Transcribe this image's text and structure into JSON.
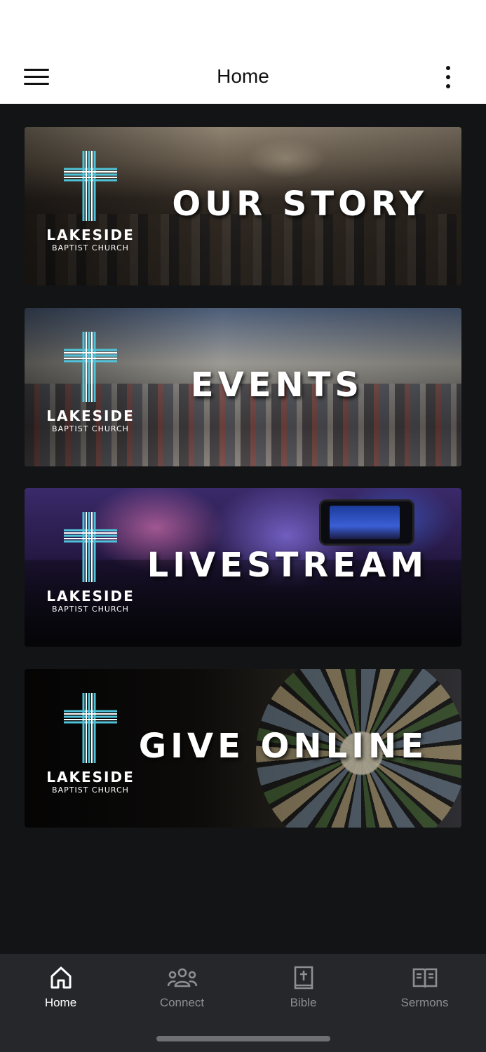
{
  "header": {
    "title": "Home",
    "menu_icon": "hamburger-menu-icon",
    "more_icon": "more-vertical-icon"
  },
  "banners": [
    {
      "title": "OUR STORY",
      "logo_name": "LAKESIDE",
      "logo_sub": "BAPTIST CHURCH"
    },
    {
      "title": "EVENTS",
      "logo_name": "LAKESIDE",
      "logo_sub": "BAPTIST CHURCH"
    },
    {
      "title": "LIVESTREAM",
      "logo_name": "LAKESIDE",
      "logo_sub": "BAPTIST CHURCH"
    },
    {
      "title": "GIVE ONLINE",
      "logo_name": "LAKESIDE",
      "logo_sub": "BAPTIST CHURCH"
    }
  ],
  "tabs": [
    {
      "label": "Home",
      "icon": "home-icon",
      "active": true
    },
    {
      "label": "Connect",
      "icon": "people-icon",
      "active": false
    },
    {
      "label": "Bible",
      "icon": "bible-icon",
      "active": false
    },
    {
      "label": "Sermons",
      "icon": "open-book-icon",
      "active": false
    }
  ],
  "colors": {
    "background": "#131416",
    "tab_bar": "#25272b",
    "logo_accent": "#4fc3d9",
    "active_tab": "#ffffff",
    "inactive_tab": "#8c8e92"
  }
}
